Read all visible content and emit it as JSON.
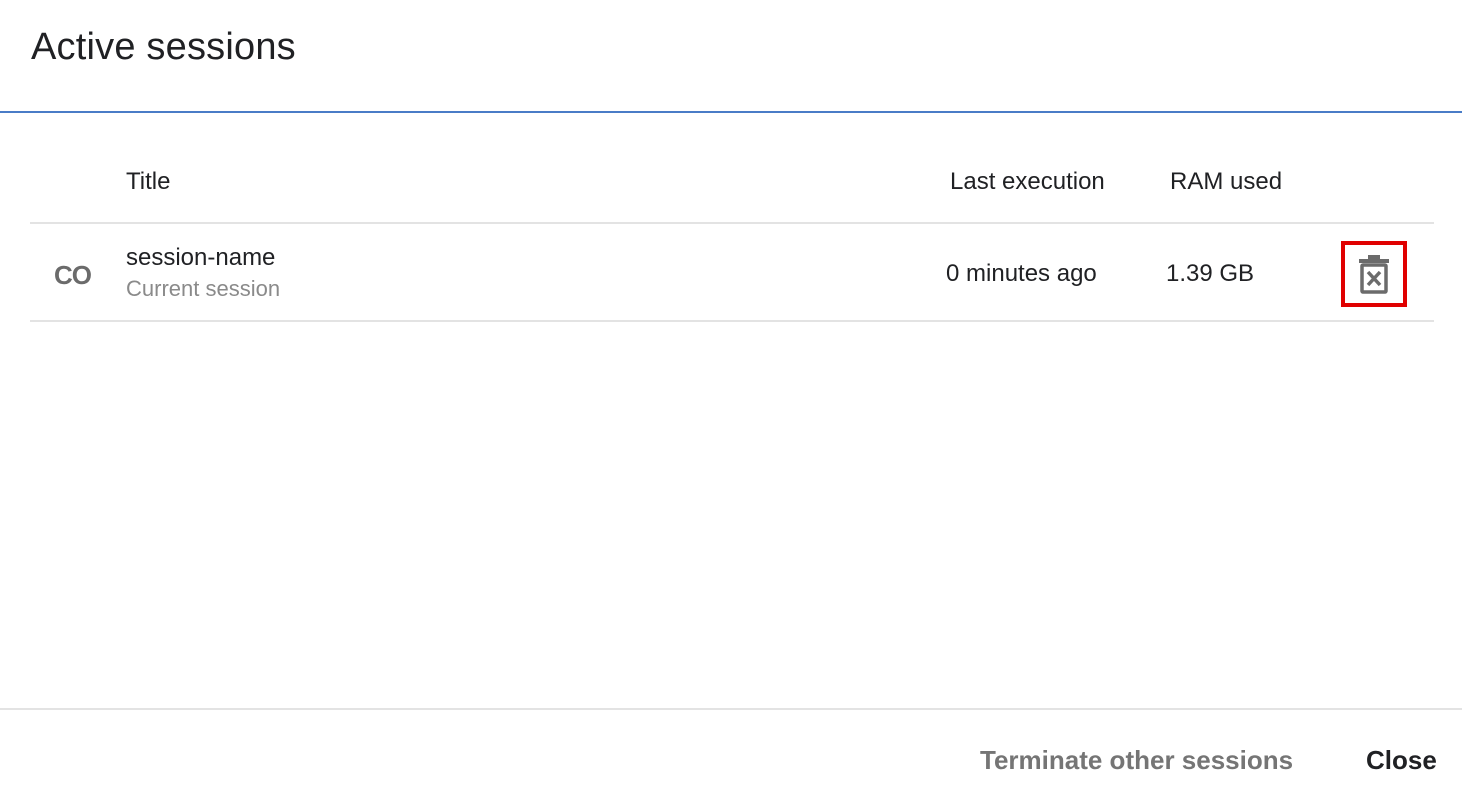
{
  "dialog": {
    "title": "Active sessions"
  },
  "table": {
    "columns": {
      "title": "Title",
      "last_execution": "Last execution",
      "ram_used": "RAM used"
    },
    "rows": [
      {
        "logo": "CO",
        "name": "session-name",
        "subtitle": "Current session",
        "last_execution": "0 minutes ago",
        "ram_used": "1.39 GB",
        "action_icon": "trash-x-icon"
      }
    ]
  },
  "footer": {
    "terminate_label": "Terminate other sessions",
    "close_label": "Close"
  },
  "colors": {
    "accent_divider": "#4a7cc7",
    "highlight": "#e00000"
  }
}
